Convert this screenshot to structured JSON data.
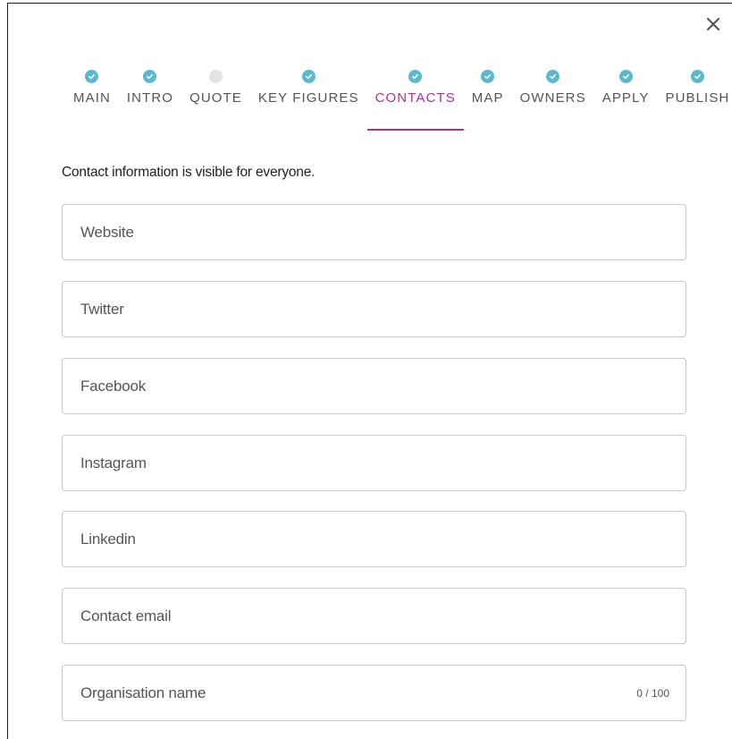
{
  "dialog": {
    "close_label": "close",
    "info_text": "Contact information is visible for everyone."
  },
  "steps": [
    {
      "label": "MAIN",
      "status": "done"
    },
    {
      "label": "INTRO",
      "status": "done"
    },
    {
      "label": "QUOTE",
      "status": "pending"
    },
    {
      "label": "KEY FIGURES",
      "status": "done"
    },
    {
      "label": "CONTACTS",
      "status": "active"
    },
    {
      "label": "MAP",
      "status": "done"
    },
    {
      "label": "OWNERS",
      "status": "done"
    },
    {
      "label": "APPLY",
      "status": "done"
    },
    {
      "label": "PUBLISH",
      "status": "done"
    }
  ],
  "fields": {
    "website": {
      "placeholder": "Website",
      "value": ""
    },
    "twitter": {
      "placeholder": "Twitter",
      "value": ""
    },
    "facebook": {
      "placeholder": "Facebook",
      "value": ""
    },
    "instagram": {
      "placeholder": "Instagram",
      "value": ""
    },
    "linkedin": {
      "placeholder": "Linkedin",
      "value": ""
    },
    "contact_email": {
      "placeholder": "Contact email",
      "value": ""
    },
    "organisation_name": {
      "placeholder": "Organisation name",
      "value": "",
      "counter": "0 / 100"
    }
  },
  "colors": {
    "accent": "#b3308f",
    "check": "#5bb8cf",
    "pending": "#e3e3e3"
  }
}
